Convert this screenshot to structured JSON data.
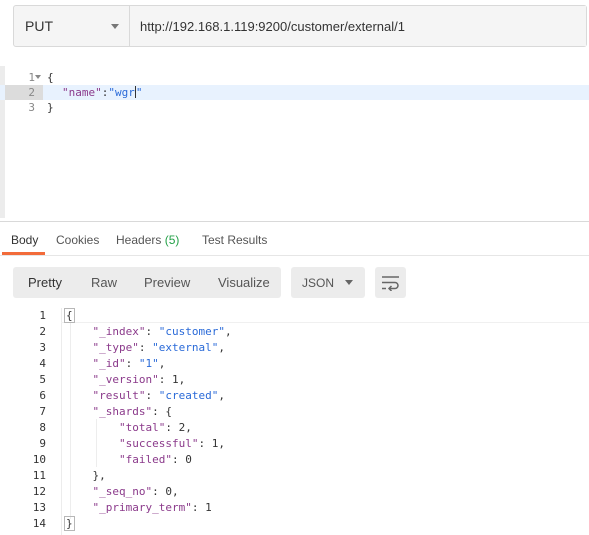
{
  "request": {
    "method": "PUT",
    "url": "http://192.168.1.119:9200/customer/external/1"
  },
  "request_body": {
    "line_numbers": [
      "1",
      "2",
      "3"
    ],
    "line1": "{",
    "line2_key": "\"name\"",
    "line2_colon": ":",
    "line2_value": "\"wgr",
    "line2_tail": "\"",
    "line3": "}"
  },
  "response_tabs": {
    "body": "Body",
    "cookies": "Cookies",
    "headers": "Headers",
    "headers_count": "(5)",
    "test_results": "Test Results"
  },
  "format_toolbar": {
    "pretty": "Pretty",
    "raw": "Raw",
    "preview": "Preview",
    "visualize": "Visualize",
    "language": "JSON",
    "wrap_icon": "wrap-lines-icon"
  },
  "response_body": {
    "line_numbers": [
      "1",
      "2",
      "3",
      "4",
      "5",
      "6",
      "7",
      "8",
      "9",
      "10",
      "11",
      "12",
      "13",
      "14"
    ],
    "l1": "{",
    "l2_key": "\"_index\"",
    "l2_value": "\"customer\"",
    "l3_key": "\"_type\"",
    "l3_value": "\"external\"",
    "l4_key": "\"_id\"",
    "l4_value": "\"1\"",
    "l5_key": "\"_version\"",
    "l5_value": "1",
    "l6_key": "\"result\"",
    "l6_value": "\"created\"",
    "l7_key": "\"_shards\"",
    "l7_value": "{",
    "l8_key": "\"total\"",
    "l8_value": "2",
    "l9_key": "\"successful\"",
    "l9_value": "1",
    "l10_key": "\"failed\"",
    "l10_value": "0",
    "l11": "},",
    "l12_key": "\"_seq_no\"",
    "l12_value": "0",
    "l13_key": "\"_primary_term\"",
    "l13_value": "1",
    "l14": "}"
  },
  "colors": {
    "accent_tab": "#f26b3a",
    "headers_count": "#24a148",
    "json_key": "#8b3a8b",
    "json_string": "#2a6ad8"
  }
}
